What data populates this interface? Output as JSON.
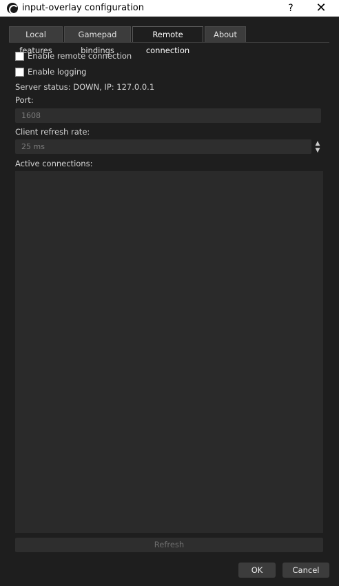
{
  "window": {
    "title": "input-overlay configuration",
    "help_glyph": "?",
    "close_glyph": "✕",
    "app_icon": "obs-icon"
  },
  "tabs": [
    {
      "label": "Local features"
    },
    {
      "label": "Gamepad bindings"
    },
    {
      "label": "Remote connection",
      "active": true
    },
    {
      "label": "About"
    }
  ],
  "remote": {
    "enable_remote_label": "Enable remote connection",
    "enable_logging_label": "Enable logging",
    "server_status": "Server status: DOWN, IP: 127.0.0.1",
    "port_label": "Port:",
    "port_value": "1608",
    "refresh_rate_label": "Client refresh rate:",
    "refresh_rate_value": "25 ms",
    "active_connections_label": "Active connections:",
    "connections": [],
    "refresh_button": "Refresh"
  },
  "dialog_buttons": {
    "ok": "OK",
    "cancel": "Cancel"
  }
}
